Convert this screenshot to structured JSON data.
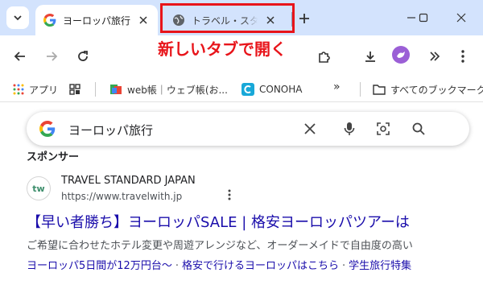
{
  "tabs": [
    {
      "title": "ヨーロッパ旅行 -",
      "favicon": "google-g-icon",
      "active": true
    },
    {
      "title": "トラベル・スタンダ",
      "favicon": "globe-icon",
      "active": false
    }
  ],
  "annotation": "新しいタブで開く",
  "accent_color": "#e8141a",
  "bookmarks": {
    "apps_label": "アプリ",
    "items": [
      {
        "label": "web帳｜ウェブ帳(お..."
      },
      {
        "label": "CONOHA"
      }
    ],
    "overflow": "»",
    "all_bookmarks_label": "すべてのブックマーク"
  },
  "search": {
    "query": "ヨーロッパ旅行"
  },
  "results": {
    "sponsor_label": "スポンサー",
    "ad": {
      "favicon_text": "tw",
      "site_name": "TRAVEL STANDARD JAPAN",
      "url": "https://www.travelwith.jp",
      "title": "【早い者勝ち】ヨーロッパSALE | 格安ヨーロッパツアーは",
      "description": "ご希望に合わせたホテル変更や周遊アレンジなど、オーダーメイドで自由度の高い",
      "sitelinks": [
        "ヨーロッパ5日間が12万円台～",
        "格安で行けるヨーロッパはこちら",
        "学生旅行特集"
      ]
    }
  }
}
